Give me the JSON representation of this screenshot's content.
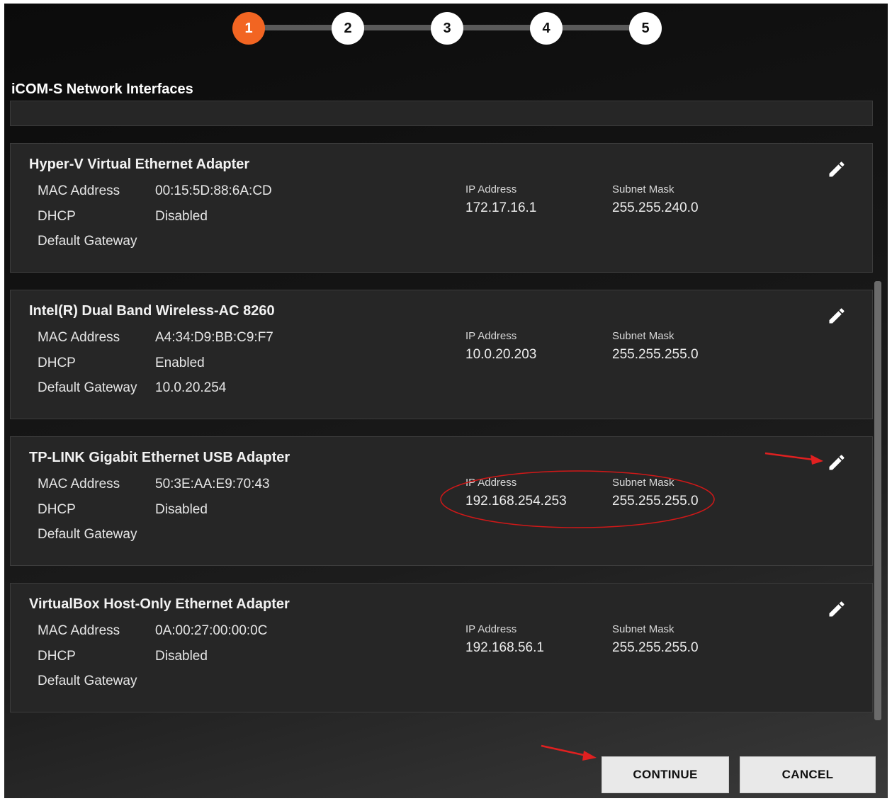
{
  "stepper": {
    "steps": [
      "1",
      "2",
      "3",
      "4",
      "5"
    ],
    "active_index": 0,
    "active_color": "#f26522"
  },
  "section_title": "iCOM-S Network Interfaces",
  "labels": {
    "mac": "MAC Address",
    "dhcp": "DHCP",
    "gateway": "Default Gateway",
    "ip": "IP Address",
    "subnet": "Subnet Mask"
  },
  "adapters": [
    {
      "name": "Hyper-V Virtual Ethernet Adapter",
      "mac": "00:15:5D:88:6A:CD",
      "dhcp": "Disabled",
      "gateway": "",
      "ip": "172.17.16.1",
      "subnet": "255.255.240.0"
    },
    {
      "name": "Intel(R) Dual Band Wireless-AC 8260",
      "mac": "A4:34:D9:BB:C9:F7",
      "dhcp": "Enabled",
      "gateway": "10.0.20.254",
      "ip": "10.0.20.203",
      "subnet": "255.255.255.0"
    },
    {
      "name": "TP-LINK Gigabit Ethernet USB Adapter",
      "mac": "50:3E:AA:E9:70:43",
      "dhcp": "Disabled",
      "gateway": "",
      "ip": "192.168.254.253",
      "subnet": "255.255.255.0"
    },
    {
      "name": "VirtualBox Host-Only Ethernet Adapter",
      "mac": "0A:00:27:00:00:0C",
      "dhcp": "Disabled",
      "gateway": "",
      "ip": "192.168.56.1",
      "subnet": "255.255.255.0"
    }
  ],
  "icons": {
    "edit": "pencil-icon"
  },
  "buttons": {
    "continue": "CONTINUE",
    "cancel": "CANCEL"
  },
  "annotation_color": "#e02020"
}
